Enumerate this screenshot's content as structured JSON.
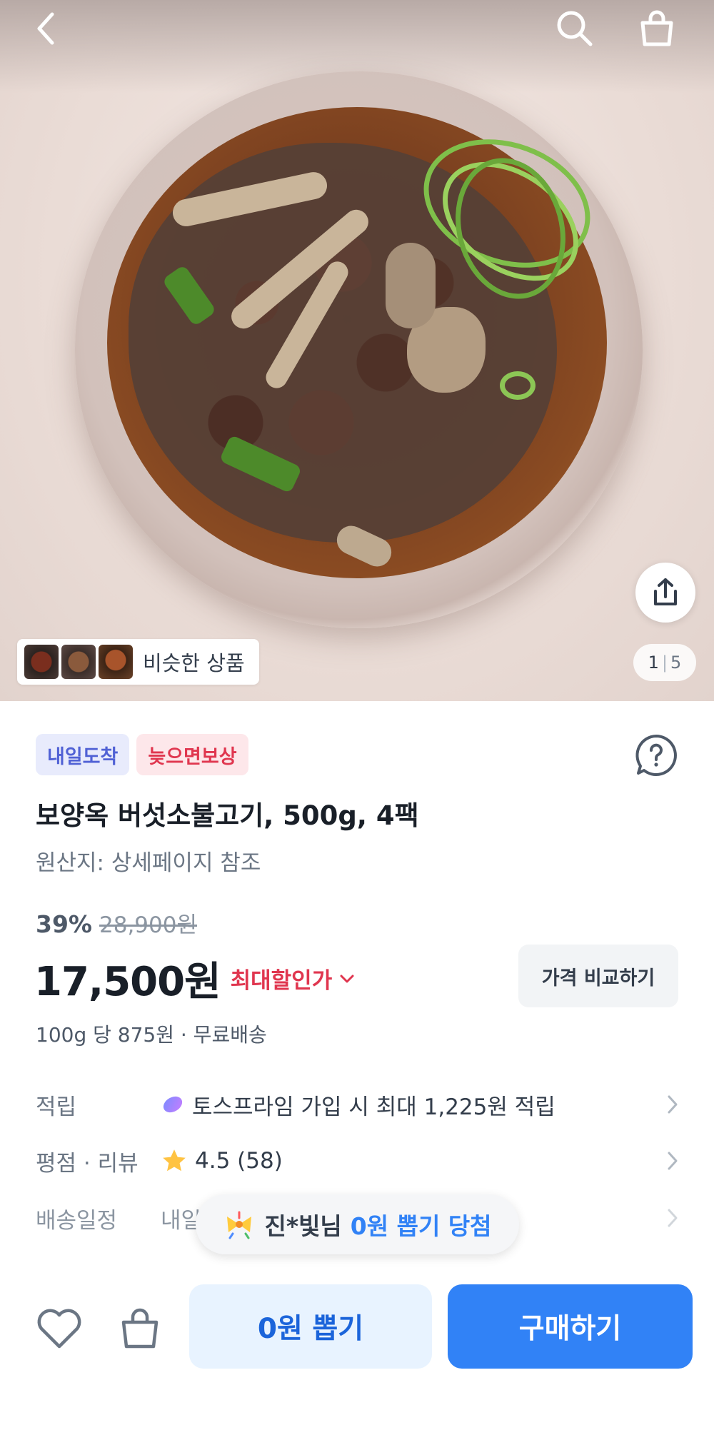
{
  "header": {
    "back_icon": "back-arrow-icon",
    "search_icon": "search-icon",
    "cart_icon": "shopping-bag-icon"
  },
  "gallery": {
    "image_description_icon": "product-photo",
    "similar_label": "비슷한 상품",
    "pager_current": "1",
    "pager_separator": "|",
    "pager_total": "5",
    "share_icon": "share-icon"
  },
  "product": {
    "badges": [
      "내일도착",
      "늦으면보상"
    ],
    "title": "보양옥 버섯소불고기, 500g, 4팩",
    "origin": "원산지: 상세페이지 참조",
    "discount_pct": "39%",
    "original_price": "28,900원",
    "price": "17,500원",
    "max_discount_label": "최대할인가",
    "compare_label": "가격 비교하기",
    "unit_price": "100g 당 875원 · 무료배송"
  },
  "info": {
    "reward_label": "적립",
    "reward_value": "토스프라임 가입 시 최대 1,225원 적립",
    "rating_label": "평점 · 리뷰",
    "rating_value": "4.5 (58)",
    "delivery_label": "배송일정",
    "delivery_value": "내일"
  },
  "toast": {
    "name": "진*빛님",
    "prize": "0원 뽑기 당첨"
  },
  "bottom": {
    "draw_label": "0원 뽑기",
    "buy_label": "구매하기"
  },
  "colors": {
    "primary": "#3182f6",
    "draw_bg": "#e8f3ff",
    "discount_red": "#e0364f",
    "badge_blue": "#5061d5"
  }
}
